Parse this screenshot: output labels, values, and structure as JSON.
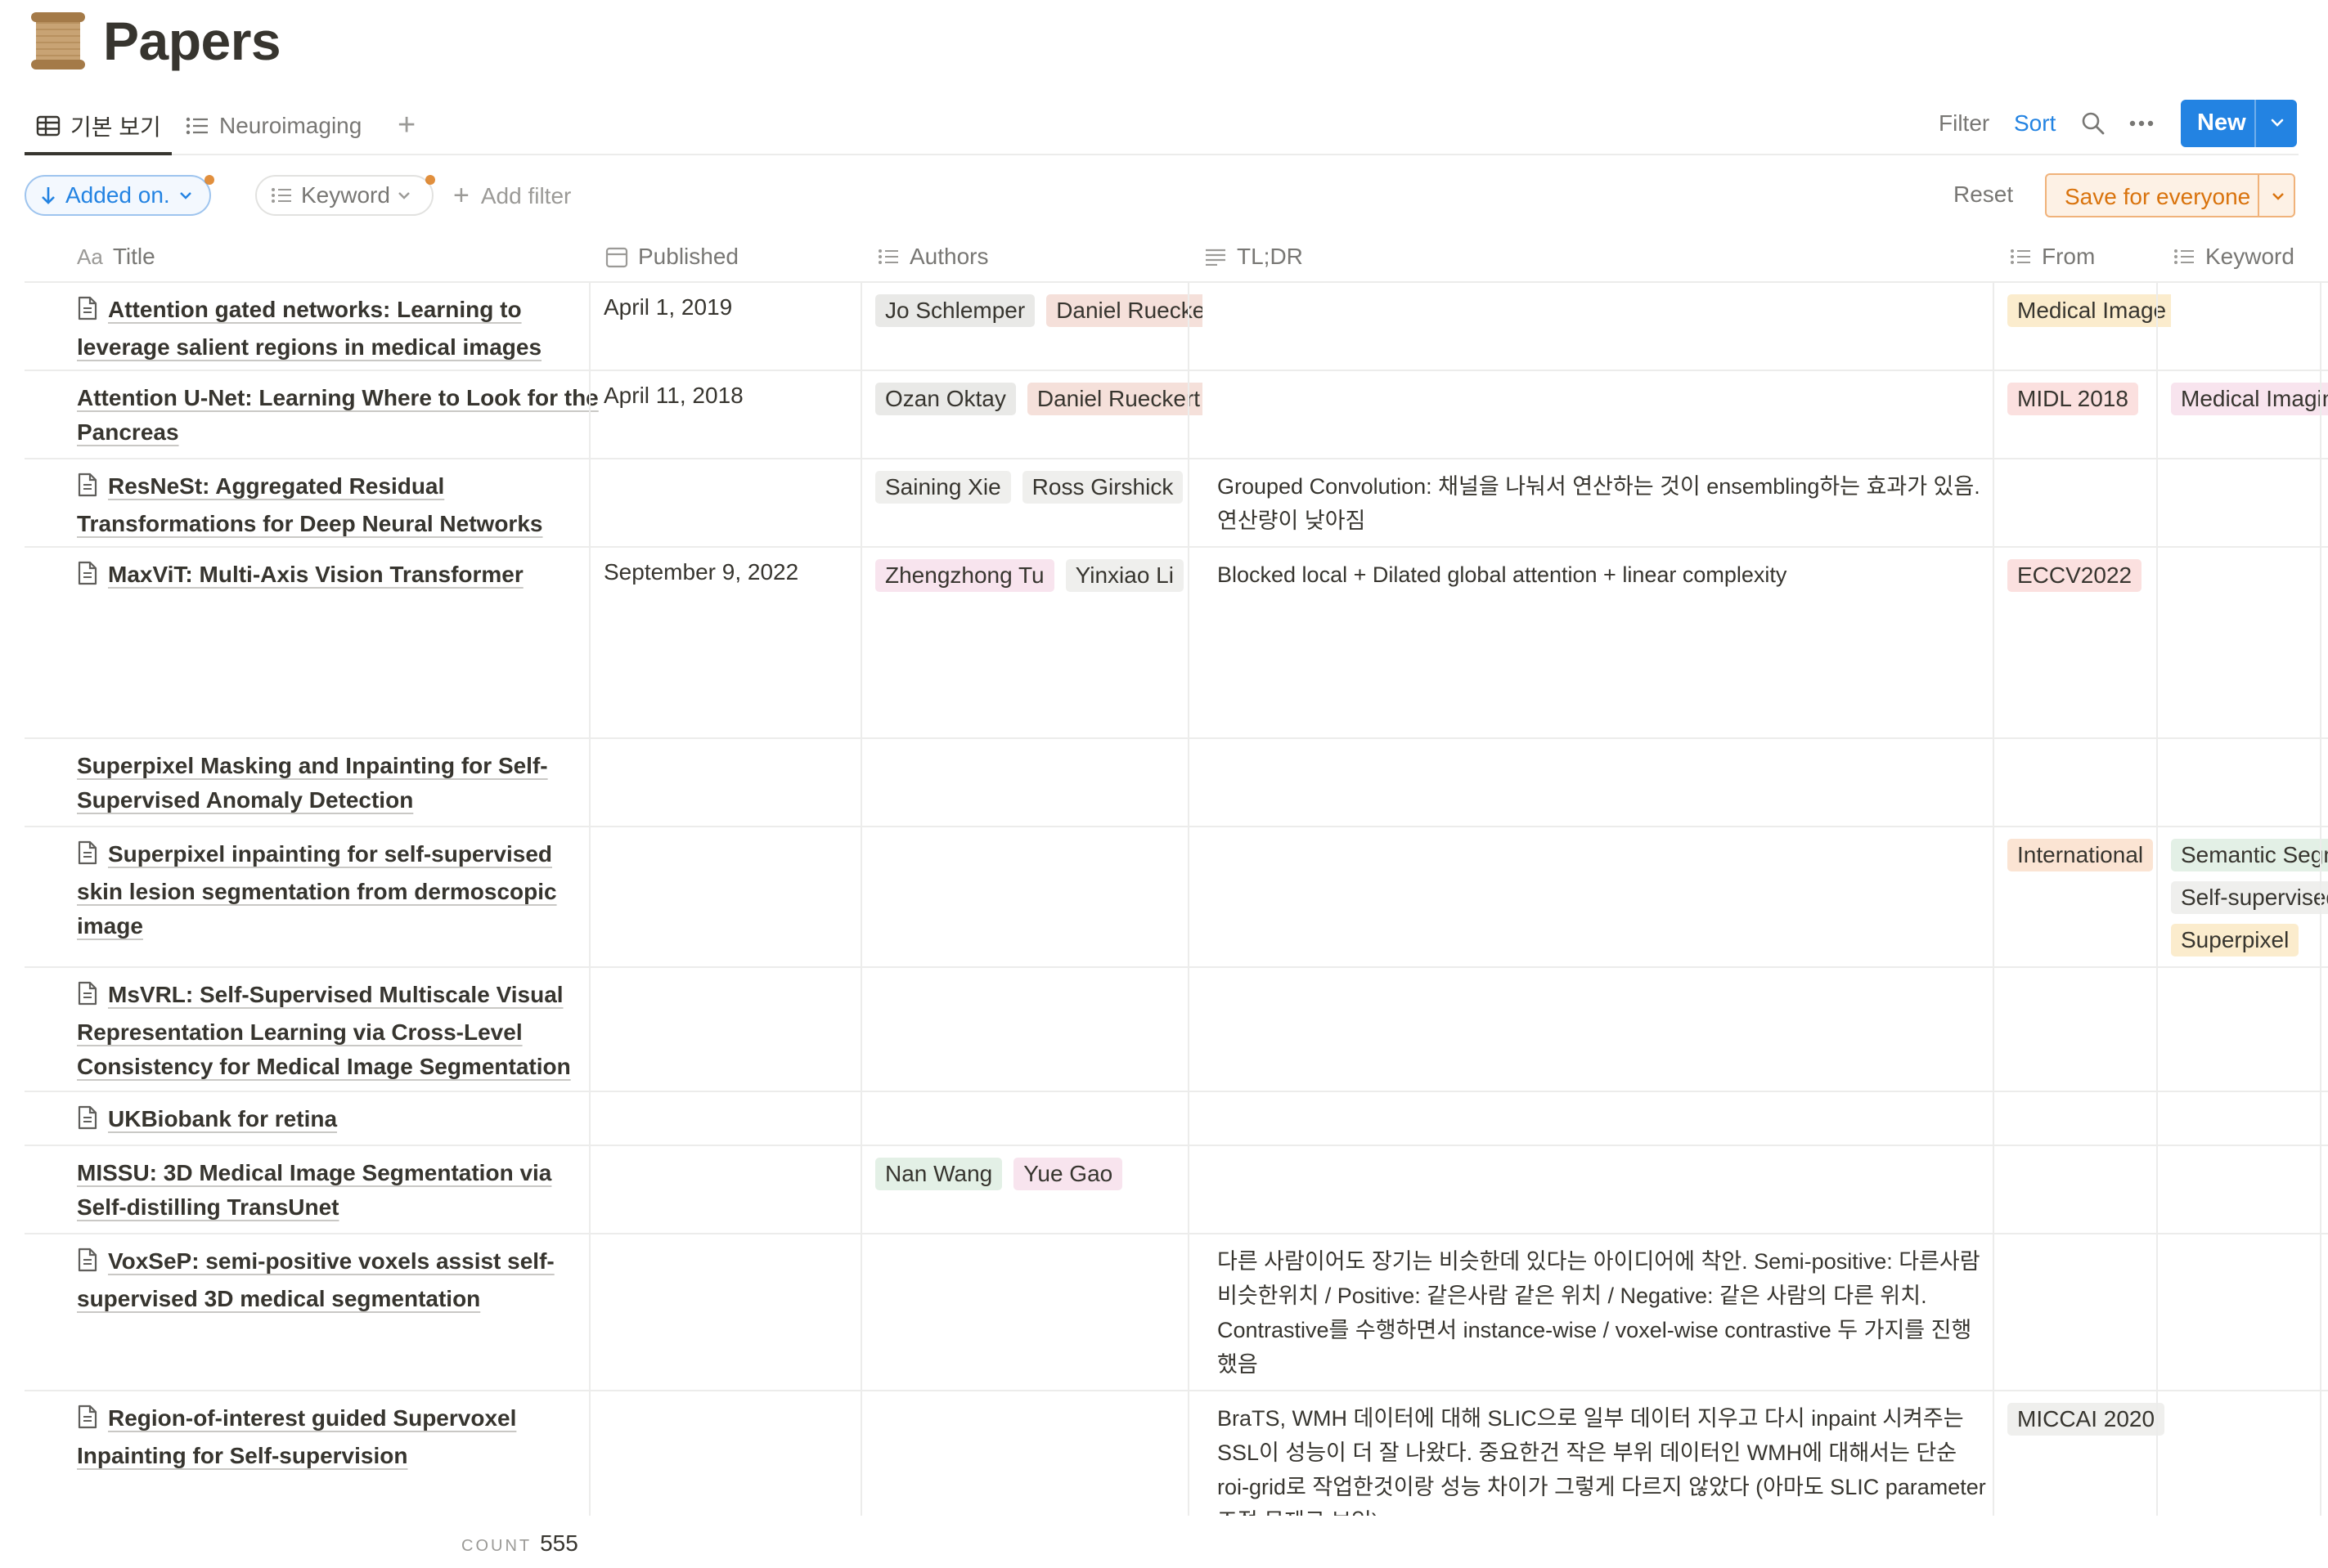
{
  "page": {
    "icon": "scroll-icon",
    "title": "Papers"
  },
  "tabs": [
    {
      "label": "기본 보기",
      "icon": "table-icon",
      "active": true
    },
    {
      "label": "Neuroimaging",
      "icon": "list-icon",
      "active": false
    }
  ],
  "toolbar": {
    "filter": "Filter",
    "sort": "Sort",
    "new": "New"
  },
  "filters": {
    "added_on": "Added on.",
    "keyword": "Keyword",
    "add_filter": "Add filter",
    "reset": "Reset",
    "save": "Save for everyone"
  },
  "columns": {
    "title": "Title",
    "title_prefix": "Aa",
    "published": "Published",
    "authors": "Authors",
    "tldr": "TL;DR",
    "from": "From",
    "keyword": "Keyword"
  },
  "rows": [
    {
      "title": "Attention gated networks: Learning to leverage salient regions in medical images",
      "doc_icon": true,
      "published": "April 1, 2019",
      "authors": [
        {
          "name": "Jo Schlemper",
          "color": "#e9e9e7"
        },
        {
          "name": "Daniel Rueckert",
          "color": "#f5e0da"
        }
      ],
      "tldr": "",
      "from": [
        {
          "name": "Medical Image Analysis",
          "color": "#fbeccd"
        }
      ],
      "keyword": []
    },
    {
      "title": "Attention U-Net: Learning Where to Look for the Pancreas",
      "doc_icon": false,
      "published": "April 11, 2018",
      "authors": [
        {
          "name": "Ozan Oktay",
          "color": "#e9e9e7"
        },
        {
          "name": "Daniel Rueckert",
          "color": "#f5e0da"
        }
      ],
      "tldr": "",
      "from": [
        {
          "name": "MIDL 2018",
          "color": "#fbe0df"
        }
      ],
      "keyword": [
        {
          "name": "Medical Imaging",
          "color": "#f8e4ee"
        }
      ]
    },
    {
      "title": "ResNeSt: Aggregated Residual Transformations for Deep Neural Networks",
      "doc_icon": true,
      "published": "",
      "authors": [
        {
          "name": "Saining Xie",
          "color": "#efefed"
        },
        {
          "name": "Ross Girshick",
          "color": "#efefed"
        }
      ],
      "tldr": "Grouped Convolution: 채널을 나눠서 연산하는 것이 ensembling하는 효과가 있음. 연산량이 낮아짐",
      "from": [],
      "keyword": []
    },
    {
      "title": "MaxViT: Multi-Axis Vision Transformer",
      "doc_icon": true,
      "published": "September 9, 2022",
      "authors": [
        {
          "name": "Zhengzhong Tu",
          "color": "#f8e4ee"
        },
        {
          "name": "Yinxiao Li",
          "color": "#efefed"
        }
      ],
      "tldr": "Blocked local + Dilated global attention + linear complexity",
      "from": [
        {
          "name": "ECCV2022",
          "color": "#fbe0df"
        }
      ],
      "keyword": []
    },
    {
      "title": "Superpixel Masking and Inpainting for Self-Supervised Anomaly Detection",
      "doc_icon": false,
      "published": "",
      "authors": [],
      "tldr": "",
      "from": [],
      "keyword": []
    },
    {
      "title": "Superpixel inpainting for self-supervised skin lesion segmentation from dermoscopic image",
      "doc_icon": true,
      "published": "",
      "authors": [],
      "tldr": "",
      "from": [
        {
          "name": "International",
          "color": "#fbe4d3"
        }
      ],
      "keyword": [
        {
          "name": "Semantic Segmentation",
          "color": "#e3f0e6"
        },
        {
          "name": "Self-supervised",
          "color": "#efefed"
        },
        {
          "name": "Superpixel",
          "color": "#fbeccd"
        }
      ]
    },
    {
      "title": "MsVRL: Self-Supervised Multiscale Visual Representation Learning via Cross-Level Consistency for Medical Image Segmentation",
      "doc_icon": true,
      "published": "",
      "authors": [],
      "tldr": "",
      "from": [],
      "keyword": []
    },
    {
      "title": "UKBiobank for retina",
      "doc_icon": true,
      "published": "",
      "authors": [],
      "tldr": "",
      "from": [],
      "keyword": []
    },
    {
      "title": "MISSU: 3D Medical Image Segmentation via Self-distilling TransUnet",
      "doc_icon": false,
      "published": "",
      "authors": [
        {
          "name": "Nan Wang",
          "color": "#e3f0e6"
        },
        {
          "name": "Yue Gao",
          "color": "#f8e4ee"
        }
      ],
      "tldr": "",
      "from": [],
      "keyword": []
    },
    {
      "title": "VoxSeP: semi-positive voxels assist self-supervised 3D medical segmentation",
      "doc_icon": true,
      "published": "",
      "authors": [],
      "tldr": "다른 사람이어도 장기는 비슷한데 있다는 아이디어에 착안. Semi-positive: 다른사람 비슷한위치 / Positive: 같은사람 같은 위치 / Negative: 같은 사람의 다른 위치. Contrastive를 수행하면서 instance-wise / voxel-wise contrastive 두 가지를 진행했음",
      "from": [],
      "keyword": []
    },
    {
      "title": "Region-of-interest guided Supervoxel Inpainting for Self-supervision",
      "doc_icon": true,
      "published": "",
      "authors": [],
      "tldr": "BraTS, WMH 데이터에 대해 SLIC으로 일부 데이터 지우고 다시 inpaint 시켜주는 SSL이 성능이 더 잘 나왔다. 중요한건 작은 부위 데이터인 WMH에 대해서는 단순 roi-grid로 작업한것이랑 성능 차이가 그렇게 다르지 않았다 (아마도 SLIC parameter 조절 문제로 보임)",
      "from": [
        {
          "name": "MICCAI 2020",
          "color": "#efefed"
        }
      ],
      "keyword": []
    }
  ],
  "footer": {
    "count_label": "COUNT",
    "count_value": "555"
  }
}
